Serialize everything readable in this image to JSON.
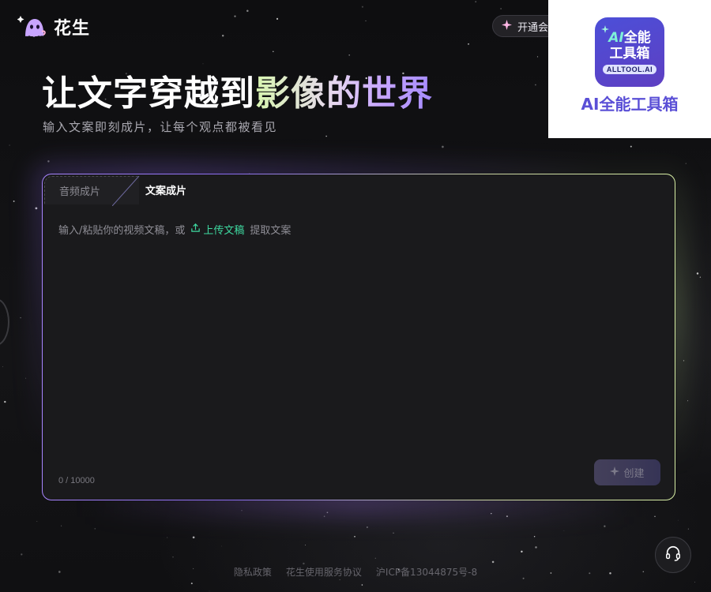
{
  "brand": {
    "name": "花生"
  },
  "header": {
    "subscribe_label": "开通会员"
  },
  "ad": {
    "logo_line1_ai": "AI",
    "logo_line1_rest": "全能",
    "logo_line2": "工具箱",
    "logo_badge": "ALLTOOL.AI",
    "caption": "AI全能工具箱"
  },
  "hero": {
    "title_plain": "让文字穿越到",
    "title_gradient": "影像的世界",
    "subtitle": "输入文案即刻成片，让每个观点都被看见"
  },
  "card": {
    "tabs": [
      {
        "label": "音频成片",
        "active": false
      },
      {
        "label": "文案成片",
        "active": true
      }
    ],
    "prompt_prefix": "输入/粘贴你的视频文稿，或",
    "upload_label": "上传文稿",
    "prompt_suffix": "提取文案",
    "counter": "0 / 10000",
    "create_label": "创建"
  },
  "footer": {
    "links": [
      "隐私政策",
      "花生使用服务协议",
      "沪ICP备13044875号-8"
    ]
  },
  "colors": {
    "accent_green": "#3ed9a0",
    "accent_purple": "#a885ff",
    "ad_purple": "#5a4fd6"
  },
  "icons": [
    "ghost-logo-icon",
    "sparkle-icon",
    "upload-icon",
    "headset-icon"
  ]
}
